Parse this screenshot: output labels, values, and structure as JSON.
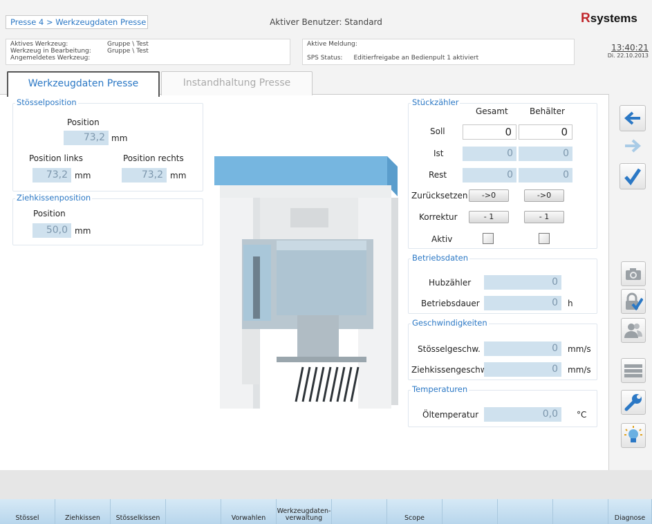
{
  "header": {
    "breadcrumb": "Presse 4 > Werkzeugdaten Presse",
    "user": "Aktiver Benutzer: Standard",
    "logo_mark": "R",
    "logo_text": "systems"
  },
  "info": {
    "active_tool_label": "Aktives Werkzeug:",
    "active_tool_value": "Gruppe \\ Test",
    "edit_tool_label": "Werkzeug in Bearbeitung:",
    "edit_tool_value": "Gruppe \\ Test",
    "registered_tool_label": "Angemeldetes Werkzeug:",
    "active_msg_label": "Aktive Meldung:",
    "sps_label": "SPS Status:",
    "sps_value": "Editierfreigabe an Bedienpult 1 aktiviert",
    "time": "13:40:21",
    "date": "Di. 22.10.2013"
  },
  "tabs": [
    "Werkzeugdaten Presse",
    "Instandhaltung Presse"
  ],
  "stoessel": {
    "title": "Stösselposition",
    "pos_label": "Position",
    "pos_value": "73,2",
    "pos_unit": "mm",
    "left_label": "Position links",
    "left_value": "73,2",
    "left_unit": "mm",
    "right_label": "Position rechts",
    "right_value": "73,2",
    "right_unit": "mm"
  },
  "ziehkissen": {
    "title": "Ziehkissenposition",
    "pos_label": "Position",
    "pos_value": "50,0",
    "pos_unit": "mm"
  },
  "stueck": {
    "title": "Stückzähler",
    "col1": "Gesamt",
    "col2": "Behälter",
    "soll": "Soll",
    "soll1": "0",
    "soll2": "0",
    "ist": "Ist",
    "ist1": "0",
    "ist2": "0",
    "rest": "Rest",
    "rest1": "0",
    "rest2": "0",
    "reset": "Zurücksetzen",
    "reset_btn": "->0",
    "korr": "Korrektur",
    "korr_btn": "- 1",
    "aktiv": "Aktiv"
  },
  "betrieb": {
    "title": "Betriebsdaten",
    "hub_label": "Hubzähler",
    "hub_value": "0",
    "dauer_label": "Betriebsdauer",
    "dauer_value": "0",
    "dauer_unit": "h"
  },
  "geschw": {
    "title": "Geschwindigkeiten",
    "st_label": "Stösselgeschw.",
    "st_value": "0",
    "st_unit": "mm/s",
    "zk_label": "Ziehkissengeschw.",
    "zk_value": "0",
    "zk_unit": "mm/s"
  },
  "temp": {
    "title": "Temperaturen",
    "oel_label": "Öltemperatur",
    "oel_value": "0,0",
    "oel_unit": "°C"
  },
  "bottom": [
    "Stössel",
    "Ziehkissen",
    "Stösselkissen",
    "",
    "Vorwahlen",
    "Werkzeugdaten-\nverwaltung",
    "",
    "Scope",
    "",
    "",
    "",
    "Diagnose"
  ],
  "icons": {
    "back": "arrow-left-icon",
    "forward": "arrow-right-icon",
    "confirm": "checkmark-icon",
    "camera": "camera-icon",
    "lock": "lock-icon",
    "users": "users-icon",
    "list": "list-icon",
    "wrench": "wrench-icon",
    "bulb": "lightbulb-icon"
  },
  "colors": {
    "accent": "#2b78c5",
    "field": "#cfe1ee",
    "press_top": "#76b6e0",
    "bottom_bar": "#c1ddf0"
  }
}
